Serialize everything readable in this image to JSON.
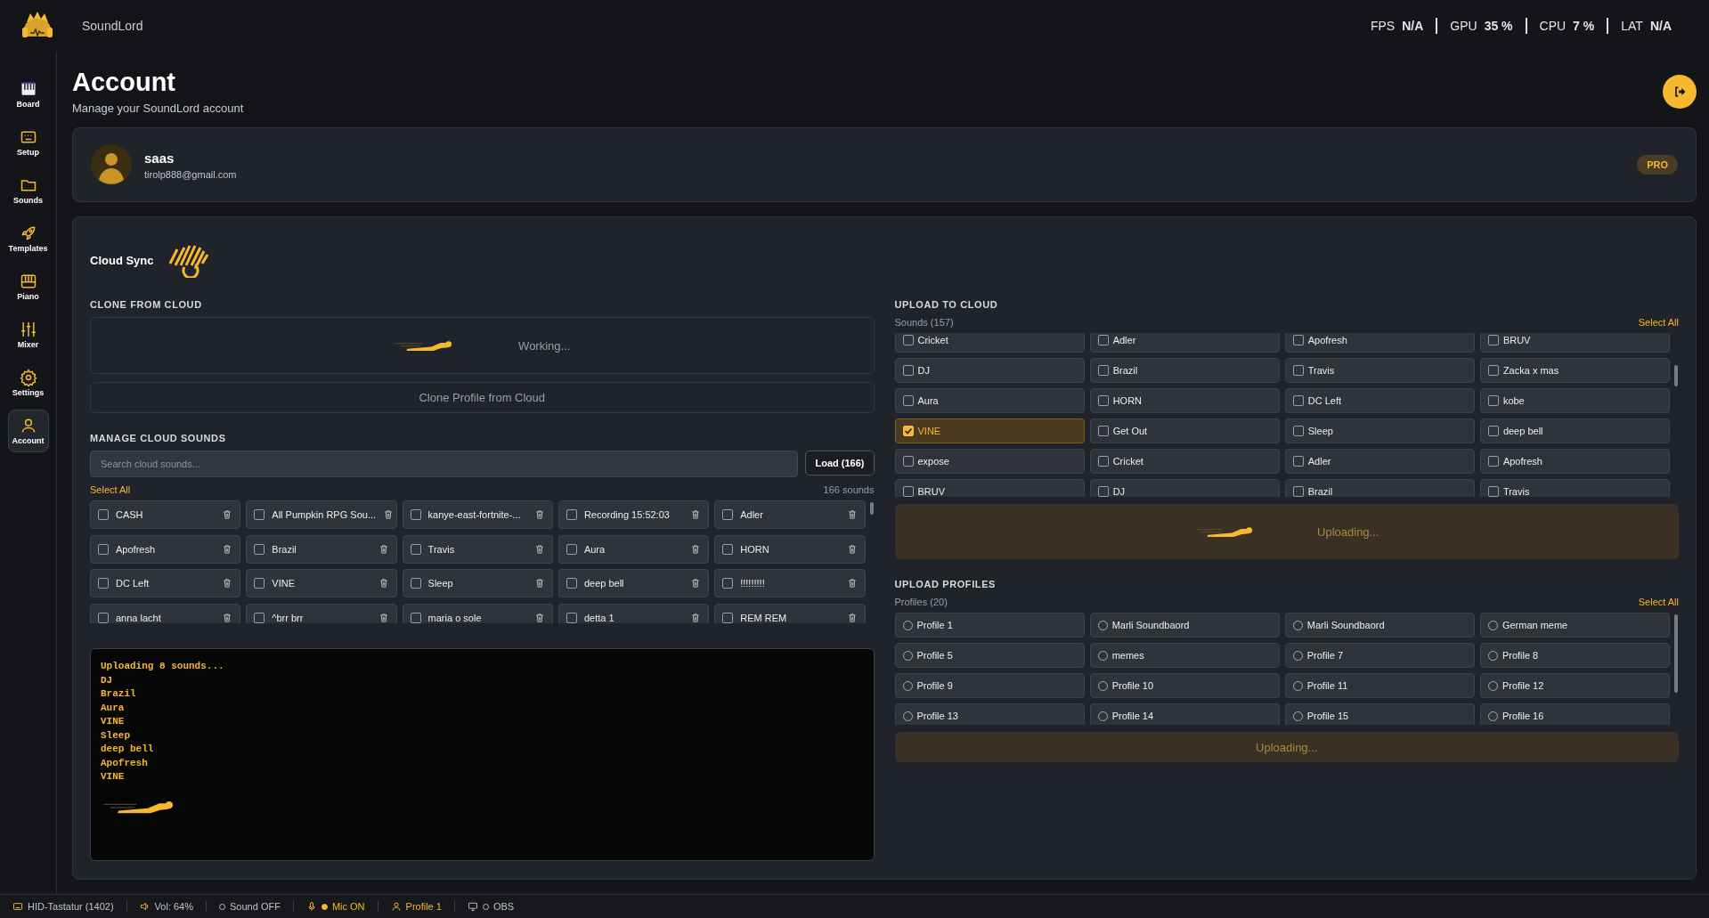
{
  "app": {
    "name": "SoundLord"
  },
  "stats": [
    {
      "label": "FPS",
      "value": "N/A"
    },
    {
      "label": "GPU",
      "value": "35 %"
    },
    {
      "label": "CPU",
      "value": "7 %"
    },
    {
      "label": "LAT",
      "value": "N/A"
    }
  ],
  "sidebar": {
    "items": [
      {
        "label": "Board",
        "kind": "board",
        "selected": false
      },
      {
        "label": "Setup",
        "kind": "setup",
        "selected": false
      },
      {
        "label": "Sounds",
        "kind": "sounds",
        "selected": false
      },
      {
        "label": "Templates",
        "kind": "templates",
        "selected": false
      },
      {
        "label": "Piano",
        "kind": "piano",
        "selected": false
      },
      {
        "label": "Mixer",
        "kind": "mixer",
        "selected": false
      },
      {
        "label": "Settings",
        "kind": "settings",
        "selected": false
      },
      {
        "label": "Account",
        "kind": "account",
        "selected": true
      }
    ]
  },
  "page": {
    "title": "Account",
    "subtitle": "Manage your SoundLord account"
  },
  "profile": {
    "username": "saas",
    "email": "tirolp888@gmail.com",
    "badge": "PRO"
  },
  "cloud_sync": {
    "title": "Cloud Sync",
    "clone": {
      "heading": "CLONE FROM CLOUD",
      "status": "Working...",
      "button": "Clone Profile from Cloud"
    },
    "manage": {
      "heading": "MANAGE CLOUD SOUNDS",
      "search": {
        "placeholder": "Search cloud sounds..."
      },
      "load_button": "Load (166)",
      "select_all": "Select All",
      "count": "166 sounds",
      "sounds": [
        {
          "name": "CASH",
          "checked": false
        },
        {
          "name": "All Pumpkin RPG Sou...",
          "checked": false
        },
        {
          "name": "kanye-east-fortnite-...",
          "checked": false
        },
        {
          "name": "Recording 15:52:03",
          "checked": false
        },
        {
          "name": "Adler",
          "checked": false
        },
        {
          "name": "Apofresh",
          "checked": false
        },
        {
          "name": "Brazil",
          "checked": false
        },
        {
          "name": "Travis",
          "checked": false
        },
        {
          "name": "Aura",
          "checked": false
        },
        {
          "name": "HORN",
          "checked": false
        },
        {
          "name": "DC Left",
          "checked": false
        },
        {
          "name": "VINE",
          "checked": false
        },
        {
          "name": "Sleep",
          "checked": false
        },
        {
          "name": "deep bell",
          "checked": false
        },
        {
          "name": "!!!!!!!!!",
          "checked": false
        },
        {
          "name": "anna lacht",
          "checked": false
        },
        {
          "name": "^brr brr",
          "checked": false
        },
        {
          "name": "maria o sole",
          "checked": false
        },
        {
          "name": "detta 1",
          "checked": false
        },
        {
          "name": "REM REM",
          "checked": false
        }
      ]
    },
    "log": [
      "Uploading 8 sounds...",
      "DJ",
      "Brazil",
      "Aura",
      "VINE",
      "Sleep",
      "deep bell",
      "Apofresh",
      "VINE"
    ],
    "upload": {
      "heading": "UPLOAD TO CLOUD",
      "label": "Sounds (157)",
      "select_all": "Select All",
      "status": "Uploading...",
      "sounds": [
        {
          "name": "Cricket",
          "checked": false
        },
        {
          "name": "Adler",
          "checked": false
        },
        {
          "name": "Apofresh",
          "checked": false
        },
        {
          "name": "BRUV",
          "checked": false
        },
        {
          "name": "DJ",
          "checked": false
        },
        {
          "name": "Brazil",
          "checked": false
        },
        {
          "name": "Travis",
          "checked": false
        },
        {
          "name": "Zacka x mas",
          "checked": false
        },
        {
          "name": "Aura",
          "checked": false
        },
        {
          "name": "HORN",
          "checked": false
        },
        {
          "name": "DC Left",
          "checked": false
        },
        {
          "name": "kobe",
          "checked": false
        },
        {
          "name": "VINE",
          "checked": true
        },
        {
          "name": "Get Out",
          "checked": false
        },
        {
          "name": "Sleep",
          "checked": false
        },
        {
          "name": "deep bell",
          "checked": false
        },
        {
          "name": "expose",
          "checked": false
        },
        {
          "name": "Cricket",
          "checked": false
        },
        {
          "name": "Adler",
          "checked": false
        },
        {
          "name": "Apofresh",
          "checked": false
        },
        {
          "name": "BRUV",
          "checked": false
        },
        {
          "name": "DJ",
          "checked": false
        },
        {
          "name": "Brazil",
          "checked": false
        },
        {
          "name": "Travis",
          "checked": false
        }
      ]
    },
    "profiles": {
      "heading": "UPLOAD PROFILES",
      "label": "Profiles (20)",
      "select_all": "Select All",
      "button": "Uploading...",
      "items": [
        {
          "name": "Profile 1",
          "selected": false
        },
        {
          "name": "Marli Soundbaord",
          "selected": false
        },
        {
          "name": "Marli Soundbaord",
          "selected": false
        },
        {
          "name": "German meme",
          "selected": false
        },
        {
          "name": "Profile 5",
          "selected": false
        },
        {
          "name": "memes",
          "selected": false
        },
        {
          "name": "Profile 7",
          "selected": false
        },
        {
          "name": "Profile 8",
          "selected": false
        },
        {
          "name": "Profile 9",
          "selected": false
        },
        {
          "name": "Profile 10",
          "selected": false
        },
        {
          "name": "Profile 11",
          "selected": false
        },
        {
          "name": "Profile 12",
          "selected": false
        },
        {
          "name": "Profile 13",
          "selected": false
        },
        {
          "name": "Profile 14",
          "selected": false
        },
        {
          "name": "Profile 15",
          "selected": false
        },
        {
          "name": "Profile 16",
          "selected": false
        }
      ]
    }
  },
  "status_bar": [
    {
      "kind": "keyboard",
      "text": "HID-Tastatur (1402)",
      "highlighted": false
    },
    {
      "kind": "volume",
      "text": "Vol: 64%",
      "highlighted": false
    },
    {
      "kind": "sound",
      "text": "Sound OFF",
      "highlighted": false
    },
    {
      "kind": "mic",
      "text": "Mic ON",
      "highlighted": true
    },
    {
      "kind": "profile",
      "text": "Profile 1",
      "highlighted": true
    },
    {
      "kind": "obs",
      "text": "OBS",
      "highlighted": false
    }
  ]
}
